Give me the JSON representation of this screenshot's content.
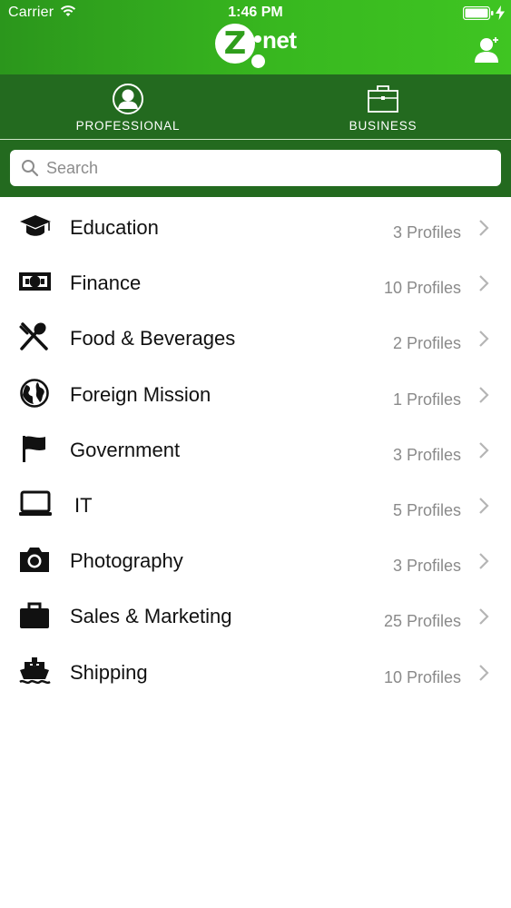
{
  "status_bar": {
    "carrier": "Carrier",
    "time": "1:46 PM"
  },
  "app": {
    "logo_letter": "Z",
    "logo_text": "net",
    "brand_color": "#38b81f",
    "tabbar_color": "#236a1f"
  },
  "tabs": [
    {
      "label": "PROFESSIONAL",
      "icon": "person-circle-icon"
    },
    {
      "label": "BUSINESS",
      "icon": "briefcase-outline-icon"
    }
  ],
  "search": {
    "placeholder": "Search",
    "value": ""
  },
  "categories": [
    {
      "label": "Education",
      "count": "3 Profiles",
      "icon": "graduation-cap-icon"
    },
    {
      "label": "Finance",
      "count": "10 Profiles",
      "icon": "money-icon"
    },
    {
      "label": "Food & Beverages",
      "count": "2 Profiles",
      "icon": "cutlery-icon"
    },
    {
      "label": "Foreign Mission",
      "count": "1 Profiles",
      "icon": "globe-icon"
    },
    {
      "label": "Government",
      "count": "3 Profiles",
      "icon": "flag-icon"
    },
    {
      "label": "IT",
      "count": "5 Profiles",
      "icon": "laptop-icon"
    },
    {
      "label": "Photography",
      "count": "3 Profiles",
      "icon": "camera-icon"
    },
    {
      "label": "Sales & Marketing",
      "count": "25 Profiles",
      "icon": "briefcase-icon"
    },
    {
      "label": "Shipping",
      "count": "10 Profiles",
      "icon": "ship-icon"
    }
  ]
}
